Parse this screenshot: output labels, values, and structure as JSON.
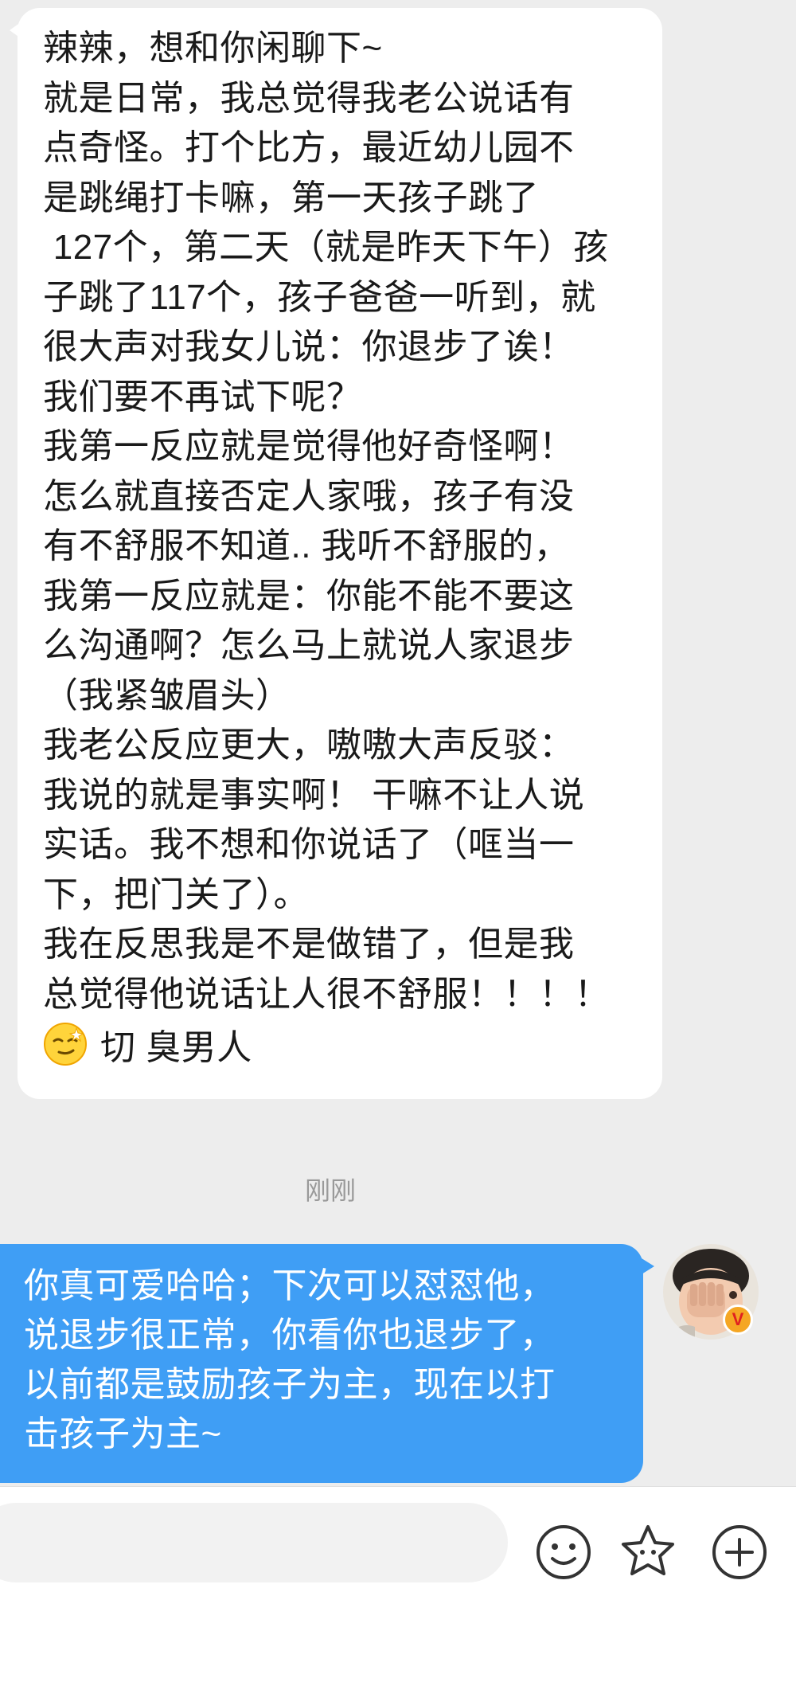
{
  "received_message": {
    "lines": [
      "辣辣，想和你闲聊下~",
      "就是日常，我总觉得我老公说话有",
      "点奇怪。打个比方，最近幼儿园不",
      "是跳绳打卡嘛，第一天孩子跳了",
      " 127个，第二天（就是昨天下午）孩",
      "子跳了117个，孩子爸爸一听到，就",
      "很大声对我女儿说：你退步了诶！",
      "我们要不再试下呢？",
      "我第一反应就是觉得他好奇怪啊！",
      "怎么就直接否定人家哦，孩子有没",
      "有不舒服不知道.. 我听不舒服的，",
      "我第一反应就是：你能不能不要这",
      "么沟通啊？怎么马上就说人家退步",
      "（我紧皱眉头）",
      "我老公反应更大，嗷嗷大声反驳：",
      "我说的就是事实啊！ 干嘛不让人说",
      "实话。我不想和你说话了（哐当一",
      "下，把门关了）。",
      "我在反思我是不是做错了，但是我",
      "总觉得他说话让人很不舒服！！！！"
    ],
    "emoji_icon": "smirk-emoji-icon",
    "last_line_text": "切 臭男人"
  },
  "timestamp": "刚刚",
  "sent_message": {
    "lines": [
      "你真可爱哈哈；下次可以怼怼他，",
      "说退步很正常，你看你也退步了，",
      "以前都是鼓励孩子为主，现在以打",
      "击孩子为主~"
    ]
  },
  "avatar": {
    "badge_text": "V",
    "badge_color": "#f5a623"
  },
  "input_bar": {
    "placeholder": "",
    "icons": [
      "smiley-icon",
      "sticker-star-icon",
      "plus-icon"
    ]
  },
  "colors": {
    "background": "#ededed",
    "received_bubble": "#ffffff",
    "sent_bubble": "#3f9ef5",
    "timestamp": "#999999"
  }
}
